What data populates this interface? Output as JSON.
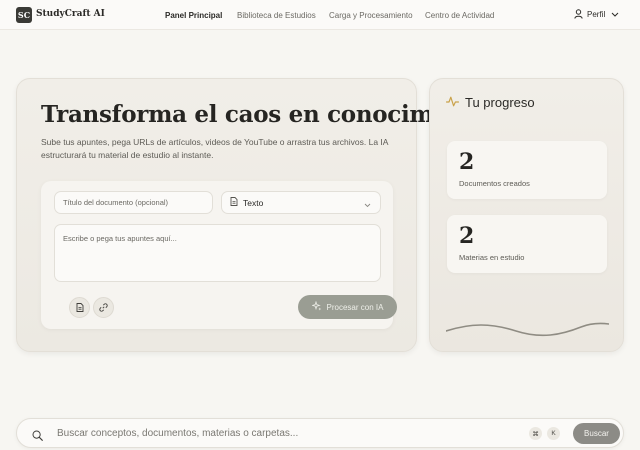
{
  "header": {
    "logo_initials": "SC",
    "logo_text": "StudyCraft AI",
    "nav": [
      {
        "label": "Panel Principal",
        "active": true
      },
      {
        "label": "Biblioteca de Estudios",
        "active": false
      },
      {
        "label": "Carga y Procesamiento",
        "active": false
      },
      {
        "label": "Centro de Actividad",
        "active": false
      }
    ],
    "profile_label": "Perfil"
  },
  "hero": {
    "headline": "Transforma el caos en conocimiento",
    "subtext": "Sube tus apuntes, pega URLs de artículos, videos de YouTube o arrastra tus archivos. La IA estructurará tu material de estudio al instante."
  },
  "form": {
    "title_placeholder": "Título del documento (opcional)",
    "type_selected": "Texto",
    "notes_placeholder": "Escribe o pega tus apuntes aquí...",
    "process_label": "Procesar con IA"
  },
  "progress": {
    "title": "Tu progreso",
    "stats": [
      {
        "value": "2",
        "label": "Documentos creados"
      },
      {
        "value": "2",
        "label": "Materias en estudio"
      }
    ]
  },
  "search": {
    "placeholder": "Buscar conceptos, documentos, materias o carpetas...",
    "shortcut_keys": [
      "⌘",
      "K"
    ],
    "button_label": "Buscar"
  },
  "colors": {
    "background": "#f7f6f2",
    "accent_gold": "#c9a24a",
    "button_gray": "#8c8b86",
    "process_button": "#9a9d93"
  }
}
